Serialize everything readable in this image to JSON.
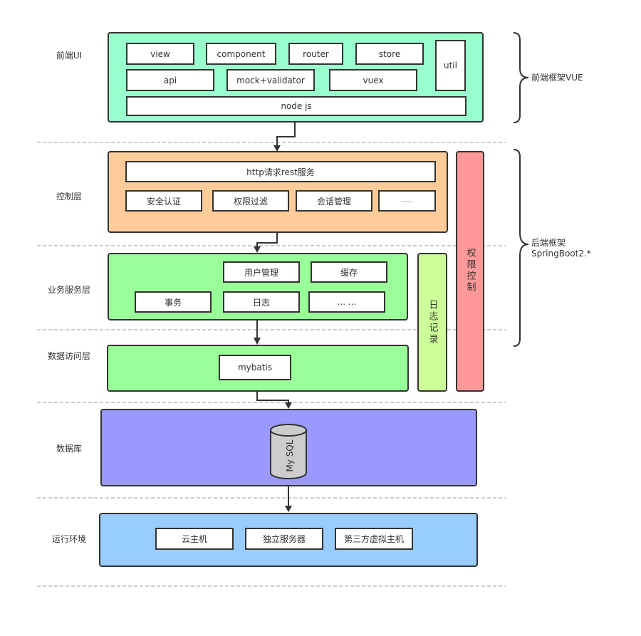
{
  "layers": {
    "frontend_ui": "前端UI",
    "control": "控制层",
    "business": "业务服务层",
    "data_access": "数据访问层",
    "database": "数据库",
    "runtime": "运行环境"
  },
  "frontend": {
    "color": "#99ffcc",
    "modules": [
      "view",
      "component",
      "router",
      "store",
      "api",
      "mock+validator",
      "vuex",
      "util",
      "node js"
    ]
  },
  "control": {
    "color": "#ffcc99",
    "top": "http请求rest服务",
    "modules": [
      "安全认证",
      "权限过滤",
      "会话管理",
      "......"
    ]
  },
  "business": {
    "color": "#99ff99",
    "modules": [
      "用户管理",
      "缓存",
      "事务",
      "日志",
      "... ..."
    ]
  },
  "data_access": {
    "color": "#99ff99",
    "modules": [
      "mybatis"
    ]
  },
  "database": {
    "color": "#9999ff",
    "db_label": "My SQL",
    "db_color": "#cccccc"
  },
  "runtime": {
    "color": "#99ccff",
    "modules": [
      "云主机",
      "独立服务器",
      "第三方虚拟主机"
    ]
  },
  "side": {
    "log": {
      "label": "日志记录",
      "color": "#ccff99"
    },
    "auth": {
      "label": "权限控制",
      "color": "#ff9999"
    }
  },
  "braces": {
    "frontend": "前端框架VUE",
    "backend_line1": "后端框架",
    "backend_line2": "SpringBoot2.*"
  }
}
